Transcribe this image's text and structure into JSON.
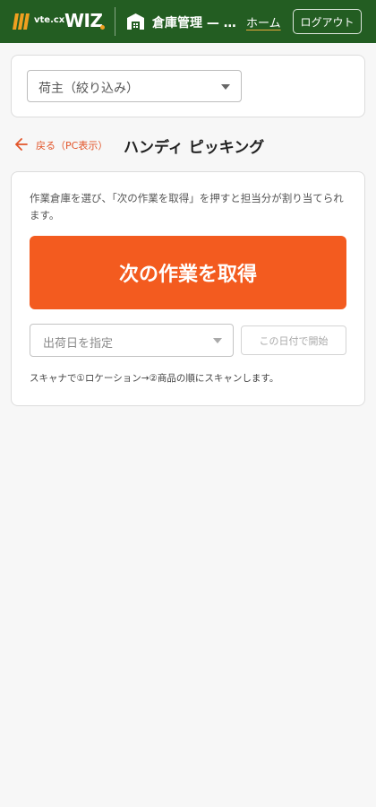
{
  "header": {
    "brand_small": "vte.cx",
    "brand_large": "WIZ",
    "app_title": "倉庫管理 — …",
    "home_label": "ホーム",
    "logout_label": "ログアウト",
    "colors": {
      "background": "#235d22",
      "accent_dot": "#f0a020",
      "logo": "#f0a020"
    },
    "icons": {
      "brand": "stripes-logo-icon",
      "app": "warehouse-icon"
    }
  },
  "filter": {
    "shipper_select_value": "荷主（絞り込み）",
    "caret_icon": "chevron-down-icon"
  },
  "nav": {
    "back_label": "戻る（PC表示）",
    "back_icon": "arrow-left-icon",
    "page_title": "ハンディ ピッキング",
    "accent_color": "#e2552a"
  },
  "main": {
    "instructions": "作業倉庫を選び、「次の作業を取得」を押すと担当分が割り当てられます。",
    "primary_button_label": "次の作業を取得",
    "primary_button_color": "#f35b1f",
    "date_select_placeholder": "出荷日を指定",
    "start_button_label": "この日付で開始",
    "hint": "スキャナで①ロケーション→②商品の順にスキャンします。"
  }
}
